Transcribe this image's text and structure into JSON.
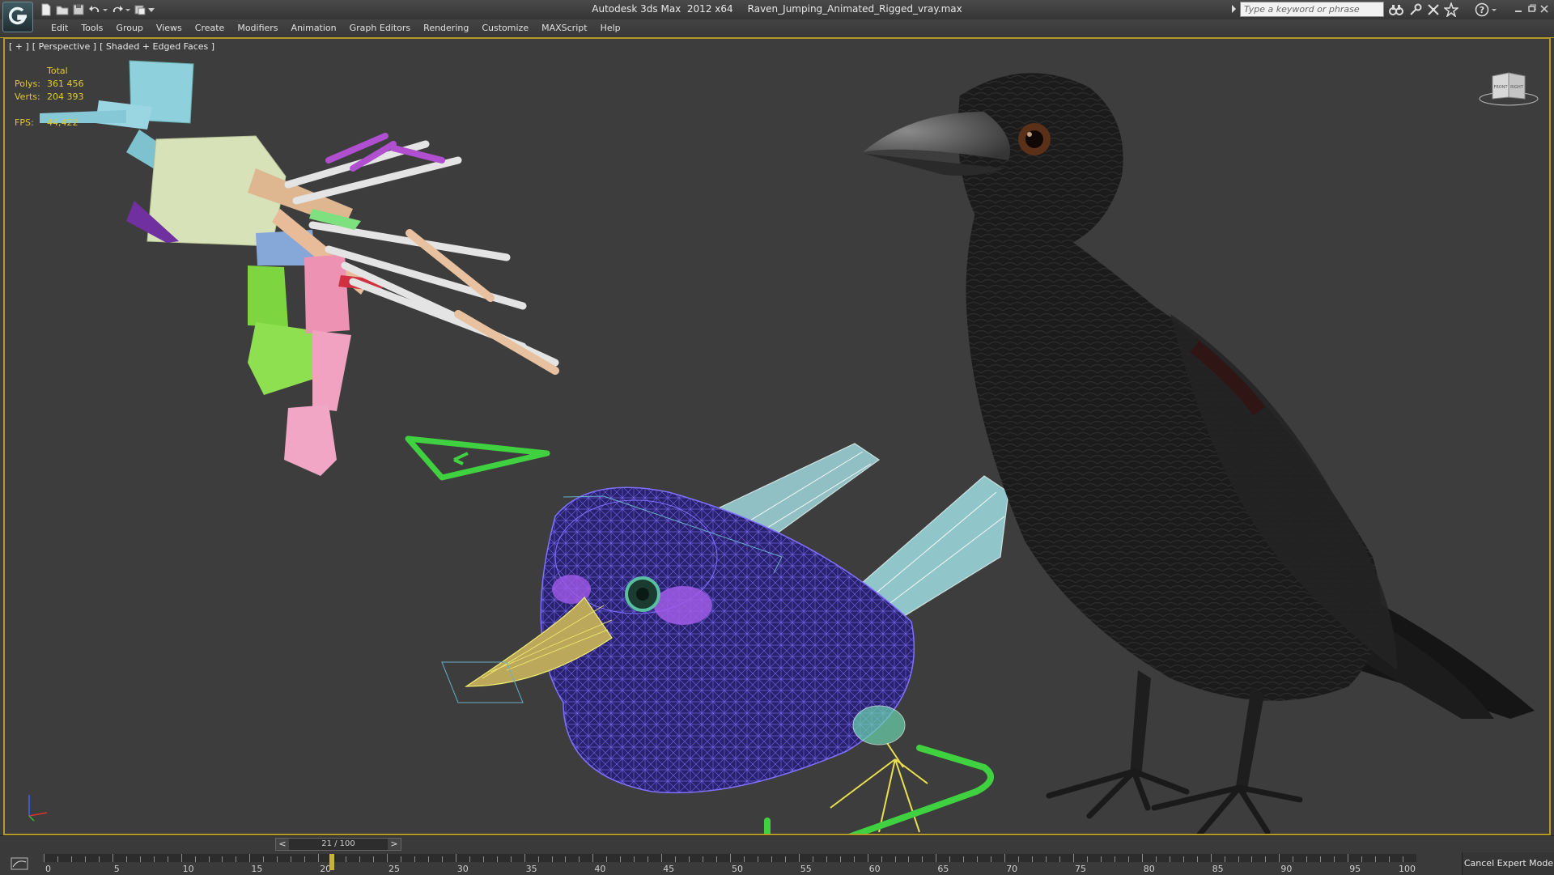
{
  "titlebar": {
    "app_title": "Autodesk 3ds Max  2012 x64",
    "file_name": "Raven_Jumping_Animated_Rigged_vray.max",
    "search_placeholder": "Type a keyword or phrase"
  },
  "menu": {
    "items": [
      "Edit",
      "Tools",
      "Group",
      "Views",
      "Create",
      "Modifiers",
      "Animation",
      "Graph Editors",
      "Rendering",
      "Customize",
      "MAXScript",
      "Help"
    ]
  },
  "viewport": {
    "label_plus": "[ + ]",
    "label_view": "[ Perspective ]",
    "label_shading": "[ Shaded + Edged Faces ]",
    "stats": {
      "header": "Total",
      "polys_label": "Polys:",
      "polys_value": "361 456",
      "verts_label": "Verts:",
      "verts_value": "204 393",
      "fps_label": "FPS:",
      "fps_value": "44,422"
    },
    "viewcube": {
      "left_face": "FRONT",
      "right_face": "RIGHT"
    }
  },
  "timeline": {
    "frame_counter": "21 / 100",
    "prev_label": "<",
    "next_label": ">",
    "current_frame": 21,
    "total_frames": 100,
    "tick_labels": [
      "0",
      "5",
      "10",
      "15",
      "20",
      "25",
      "30",
      "35",
      "40",
      "45",
      "50",
      "55",
      "60",
      "65",
      "70",
      "75",
      "80",
      "85",
      "90",
      "95",
      "100"
    ]
  },
  "status": {
    "cancel_expert_mode": "Cancel Expert Mode"
  },
  "colors": {
    "accent_border": "#b59a2a",
    "stats_text": "#e3c830",
    "viewport_bg": "#3d3d3d",
    "wire_body": "#3a2f8f",
    "control_green": "#3fd13f"
  }
}
